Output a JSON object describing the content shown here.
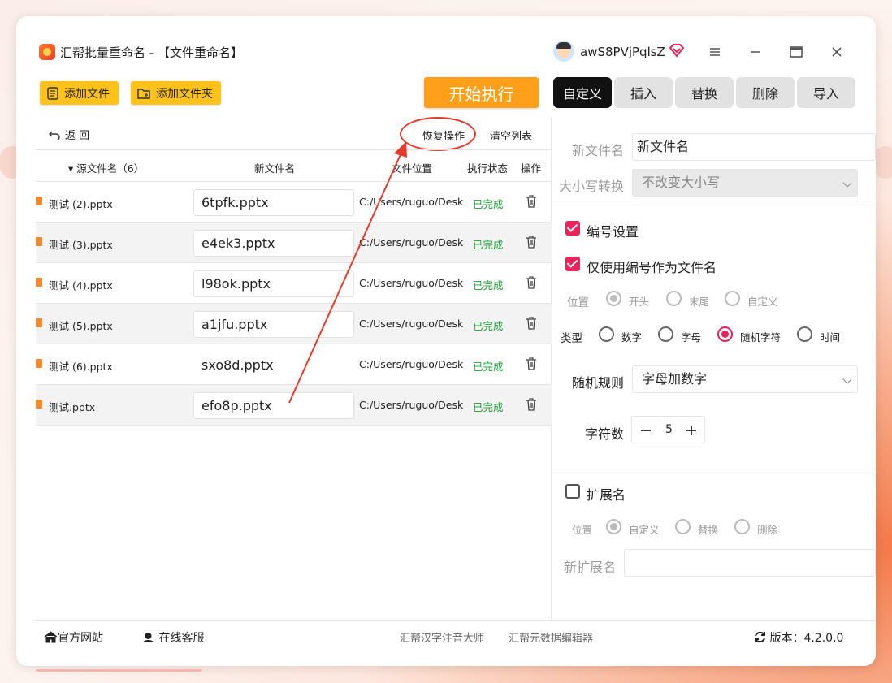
{
  "app": {
    "title": "汇帮批量重命名 - 【文件重命名】",
    "user": "awS8PVjPqlsZ"
  },
  "toolbar": {
    "add_file": "添加文件",
    "add_folder": "添加文件夹",
    "start": "开始执行"
  },
  "tabs": [
    "自定义",
    "插入",
    "替换",
    "删除",
    "导入"
  ],
  "list_actions": {
    "undo": "返 回",
    "restore": "恢复操作",
    "clear": "清空列表"
  },
  "table": {
    "headers": {
      "source": "源文件名（6）",
      "new_name": "新文件名",
      "location": "文件位置",
      "status": "执行状态",
      "action": "操作"
    },
    "rows": [
      {
        "source": "测试 (2).pptx",
        "new_name": "6tpfk.pptx",
        "location": "C:/Users/ruguo/Desktop",
        "status": "已完成"
      },
      {
        "source": "测试 (3).pptx",
        "new_name": "e4ek3.pptx",
        "location": "C:/Users/ruguo/Desktop",
        "status": "已完成"
      },
      {
        "source": "测试 (4).pptx",
        "new_name": "l98ok.pptx",
        "location": "C:/Users/ruguo/Desktop",
        "status": "已完成"
      },
      {
        "source": "测试 (5).pptx",
        "new_name": "a1jfu.pptx",
        "location": "C:/Users/ruguo/Desktop",
        "status": "已完成"
      },
      {
        "source": "测试 (6).pptx",
        "new_name": "sxo8d.pptx",
        "location": "C:/Users/ruguo/Desktop",
        "status": "已完成"
      },
      {
        "source": "测试.pptx",
        "new_name": "efo8p.pptx",
        "location": "C:/Users/ruguo/Desktop",
        "status": "已完成"
      }
    ]
  },
  "panel": {
    "new_name_label": "新文件名",
    "new_name_value": "新文件名",
    "case_label": "大小写转换",
    "case_value": "不改变大小写",
    "numbering_label": "编号设置",
    "numbering_checked": true,
    "only_number_label": "仅使用编号作为文件名",
    "only_number_checked": true,
    "position_label": "位置",
    "position_options": [
      "开头",
      "末尾",
      "自定义"
    ],
    "position_selected": "开头",
    "type_label": "类型",
    "type_options": [
      "数字",
      "字母",
      "随机字符",
      "时间"
    ],
    "type_selected": "随机字符",
    "random_rule_label": "随机规则",
    "random_rule_value": "字母加数字",
    "char_count_label": "字符数",
    "char_count_value": "5",
    "ext_label": "扩展名",
    "ext_checked": false,
    "ext_position_label": "位置",
    "ext_position_options": [
      "自定义",
      "替换",
      "删除"
    ],
    "ext_position_selected": "自定义",
    "new_ext_label": "新扩展名",
    "new_ext_value": ""
  },
  "footer": {
    "website": "官方网站",
    "support": "在线客服",
    "link1": "汇帮汉字注音大师",
    "link2": "汇帮元数据编辑器",
    "version": "版本：4.2.0.0"
  },
  "colors": {
    "accent_pink": "#e8245a",
    "toolbar_yellow": "#ffc21a",
    "start_orange": "#ff9f1a",
    "status_green": "#1aa135",
    "annotation_red": "#e53a2e"
  }
}
